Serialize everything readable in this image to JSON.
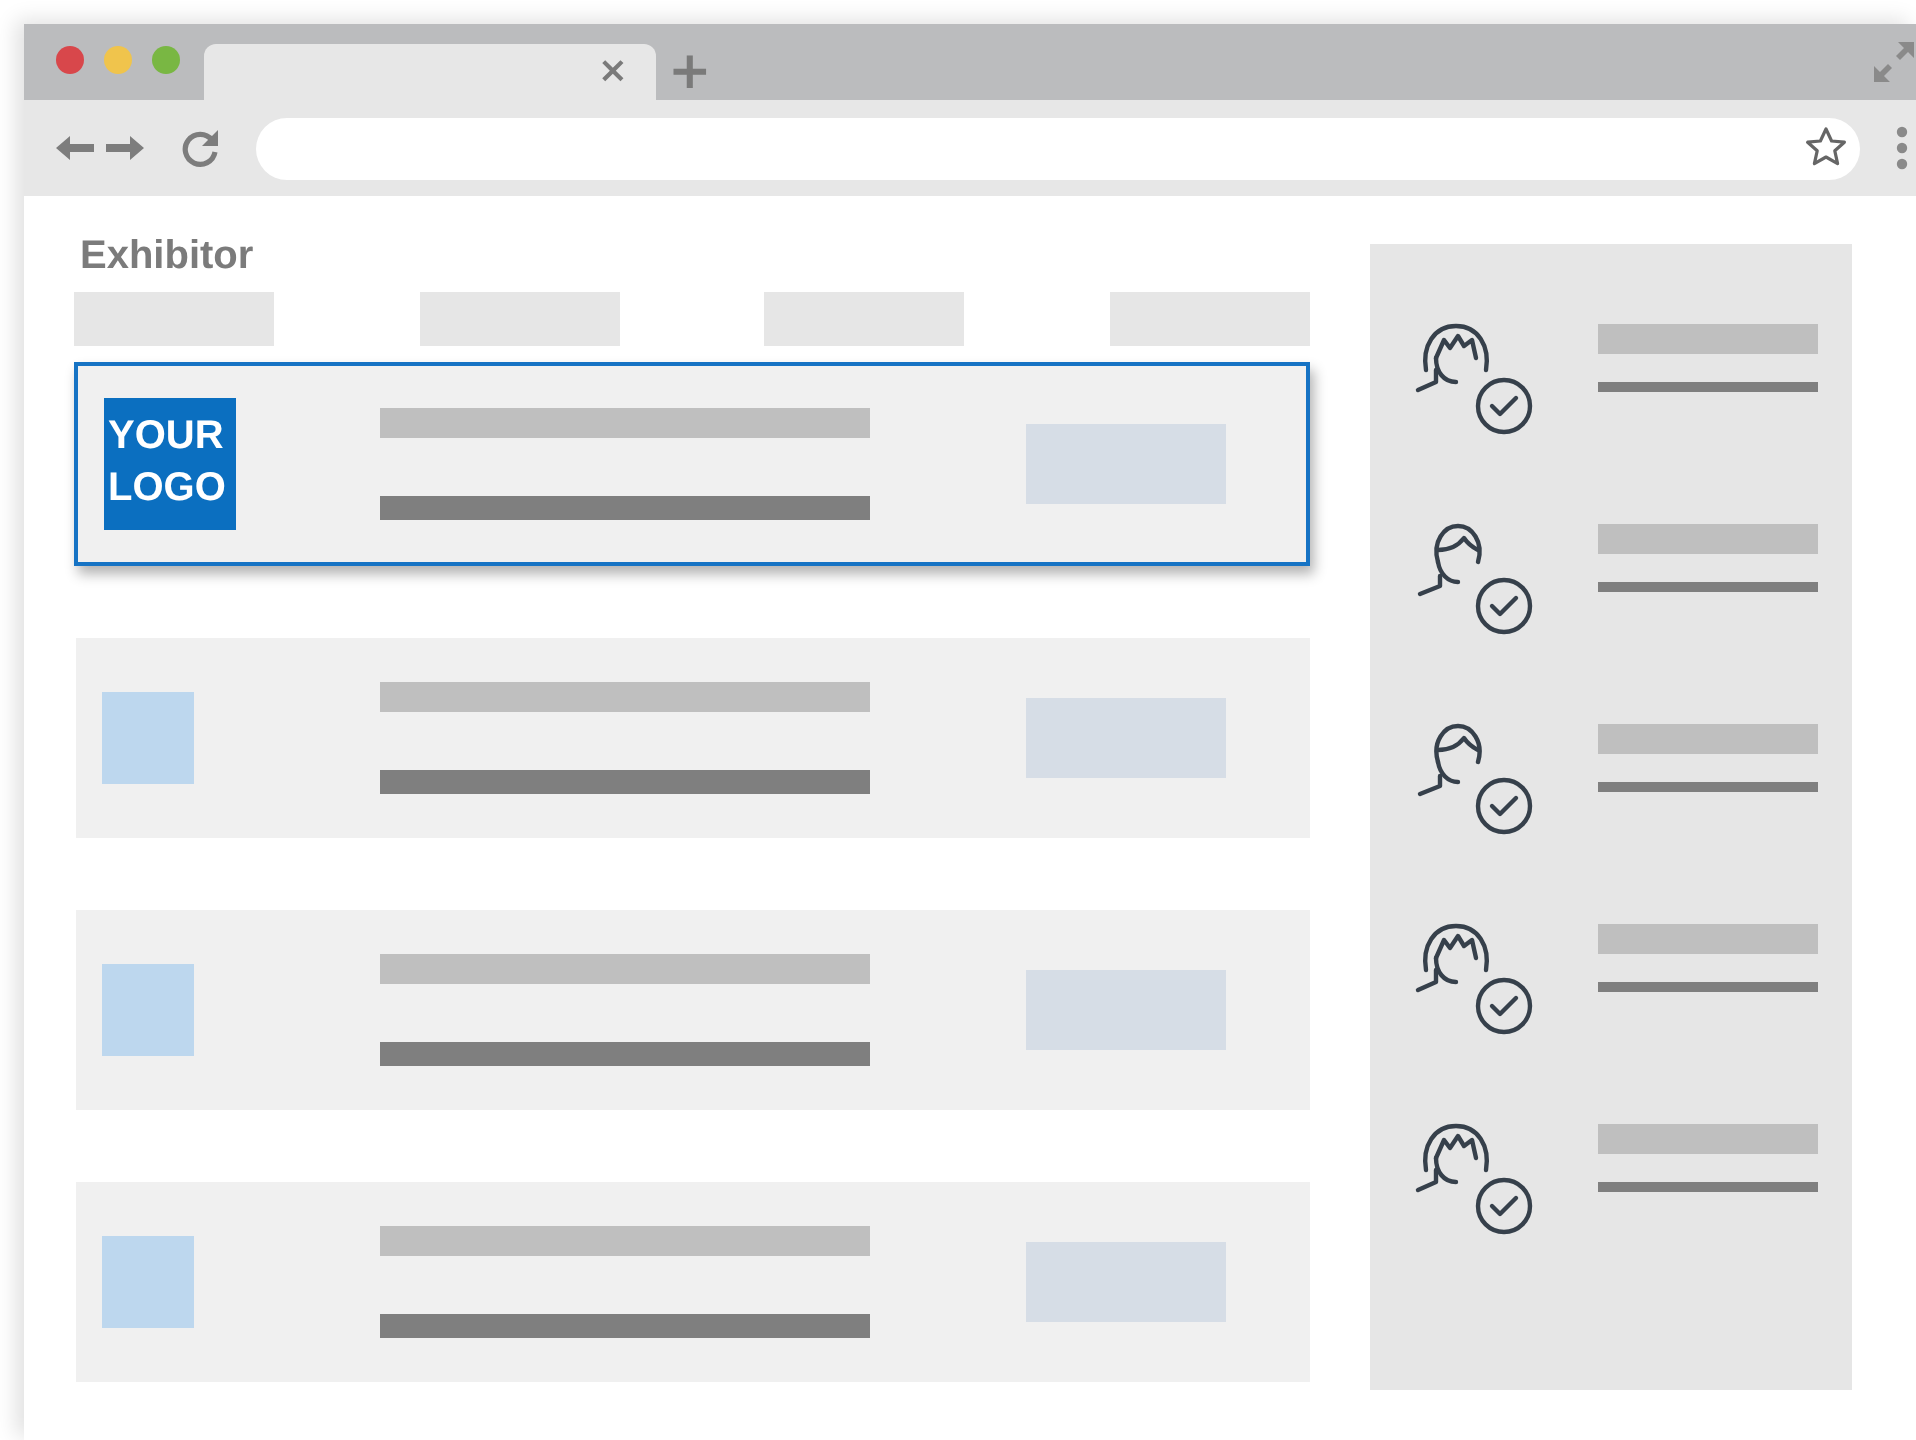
{
  "tab": {
    "close": "×",
    "new_tab": "+"
  },
  "page": {
    "title": "Exhibitor"
  },
  "rows": [
    {
      "kind": "logo",
      "logo": "YOUR LOGO",
      "selected": true
    },
    {
      "kind": "placeholder",
      "selected": false
    },
    {
      "kind": "placeholder",
      "selected": false
    },
    {
      "kind": "placeholder",
      "selected": false
    }
  ],
  "sidebar": {
    "items": [
      {
        "kind": "female"
      },
      {
        "kind": "male"
      },
      {
        "kind": "male"
      },
      {
        "kind": "female"
      },
      {
        "kind": "female"
      }
    ]
  }
}
